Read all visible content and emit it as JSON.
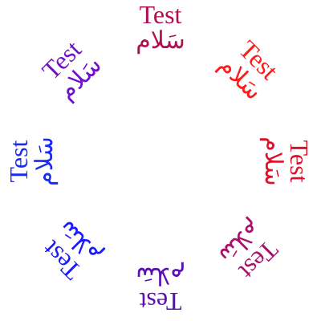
{
  "labels": [
    {
      "id": "top",
      "latin": "Test",
      "arabic": "سَلام",
      "color": "#b0104f"
    },
    {
      "id": "top-right",
      "latin": "Test",
      "arabic": "سَلام",
      "color": "#ff1a1a"
    },
    {
      "id": "right",
      "latin": "Test",
      "arabic": "سَلام",
      "color": "#e0102a"
    },
    {
      "id": "bottom-right",
      "latin": "Test",
      "arabic": "سَلام",
      "color": "#a8106a"
    },
    {
      "id": "bottom",
      "latin": "Test",
      "arabic": "سَلام",
      "color": "#5a10b0"
    },
    {
      "id": "bottom-left",
      "latin": "Test",
      "arabic": "سَلام",
      "color": "#1a1aff"
    },
    {
      "id": "left",
      "latin": "Test",
      "arabic": "سَلام",
      "color": "#1a2aee"
    },
    {
      "id": "top-left",
      "latin": "Test",
      "arabic": "سَلام",
      "color": "#7010c8"
    }
  ]
}
